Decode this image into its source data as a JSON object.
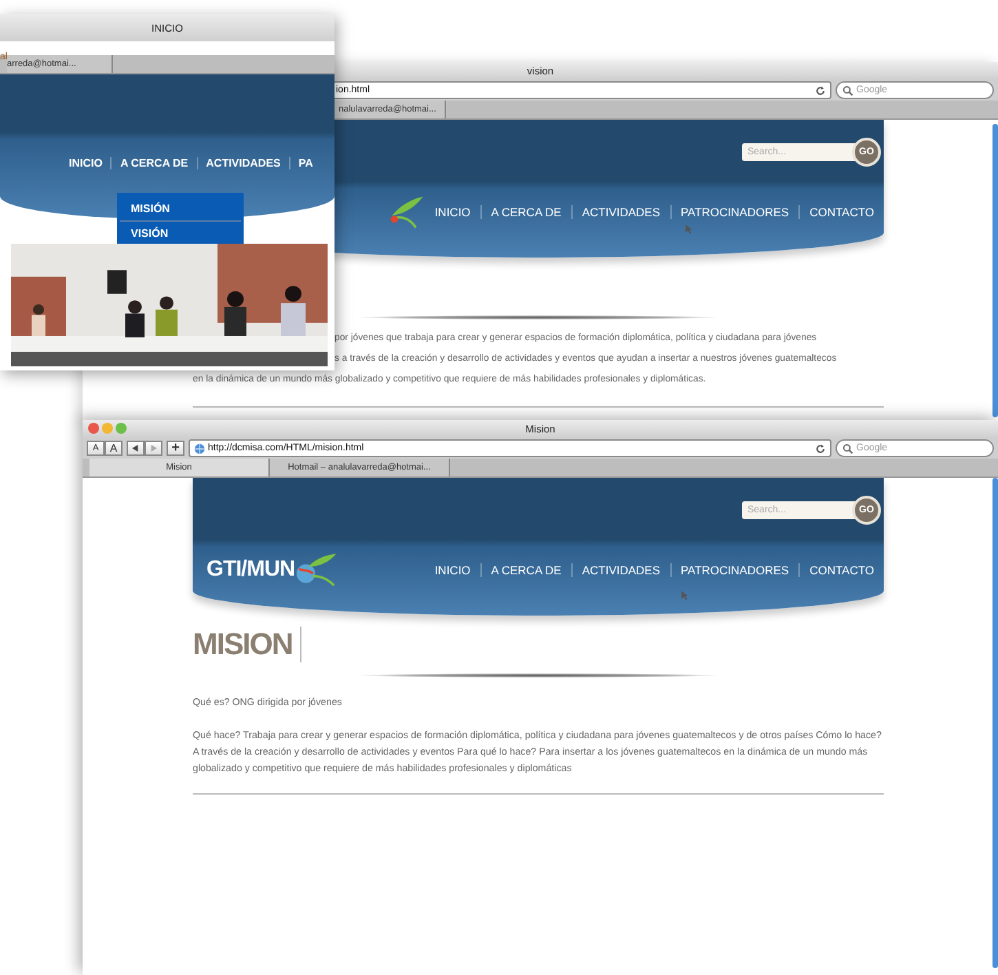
{
  "back_window": {
    "title": "vision",
    "address": "ion.html",
    "search_placeholder": "Google",
    "tabs": [
      {
        "label": "nalulavarreda@hotmai..."
      }
    ],
    "site": {
      "search_placeholder": "Search...",
      "search_button": "GO",
      "nav": [
        "INICIO",
        "A CERCA DE",
        "ACTIVIDADES",
        "PATROCINADORES",
        "CONTACTO"
      ]
    },
    "text_lines": [
      "por jóvenes que trabaja para crear y generar espacios de formación diplomática, política y ciudadana para jóvenes",
      "s a través de la creación y desarrollo de actividades y eventos que ayudan a insertar a nuestros jóvenes guatemaltecos",
      "en la dinámica de un mundo más globalizado y competitivo que requiere de más habilidades profesionales y diplomáticas."
    ]
  },
  "left_window": {
    "title": "INICIO",
    "address": "al",
    "tabs": [
      {
        "label": "arreda@hotmai..."
      }
    ],
    "nav": [
      "INICIO",
      "A CERCA DE",
      "ACTIVIDADES",
      "PA"
    ],
    "dropdown": [
      "MISIÓN",
      "VISIÓN"
    ],
    "photo": {
      "kind": "picture"
    }
  },
  "front_window": {
    "title": "Mision",
    "text_size_buttons": [
      "A",
      "A"
    ],
    "add_button": "+",
    "address": "http://dcmisa.com/HTML/mision.html",
    "search_placeholder": "Google",
    "tabs": [
      {
        "label": "Mision",
        "selected": true
      },
      {
        "label": "Hotmail – analulavarreda@hotmai...",
        "selected": false
      }
    ],
    "site": {
      "logo": "GTI/MUN",
      "search_placeholder": "Search...",
      "search_button": "GO",
      "nav": [
        "INICIO",
        "A CERCA DE",
        "ACTIVIDADES",
        "PATROCINADORES",
        "CONTACTO"
      ]
    },
    "heading": "MISION",
    "paragraphs": [
      "Qué es? ONG dirigida por jóvenes",
      "Qué hace? Trabaja para crear y generar espacios de formación diplomática, política y ciudadana para jóvenes guatemaltecos y de otros países Cómo lo hace? A través de la creación y desarrollo de actividades y eventos Para qué lo hace? Para insertar a los jóvenes guatemaltecos en la dinámica de un mundo más globalizado y competitivo que requiere de más habilidades profesionales y diplomáticas"
    ]
  }
}
